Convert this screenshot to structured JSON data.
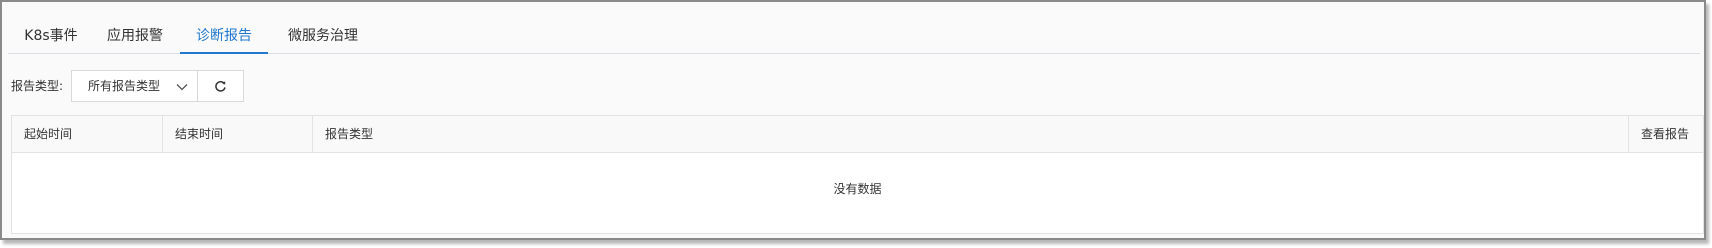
{
  "tabs": [
    {
      "label": "K8s事件",
      "active": false
    },
    {
      "label": "应用报警",
      "active": false
    },
    {
      "label": "诊断报告",
      "active": true
    },
    {
      "label": "微服务治理",
      "active": false
    }
  ],
  "filter": {
    "label": "报告类型:",
    "select_value": "所有报告类型",
    "refresh_icon": "refresh-icon",
    "dropdown_icon": "chevron-down-icon"
  },
  "table": {
    "columns": [
      "起始时间",
      "结束时间",
      "报告类型",
      "查看报告"
    ],
    "rows": [],
    "empty_text": "没有数据"
  },
  "colors": {
    "accent": "#2178cc",
    "border": "#e3e3e3",
    "header_bg": "#f9f9f9"
  }
}
